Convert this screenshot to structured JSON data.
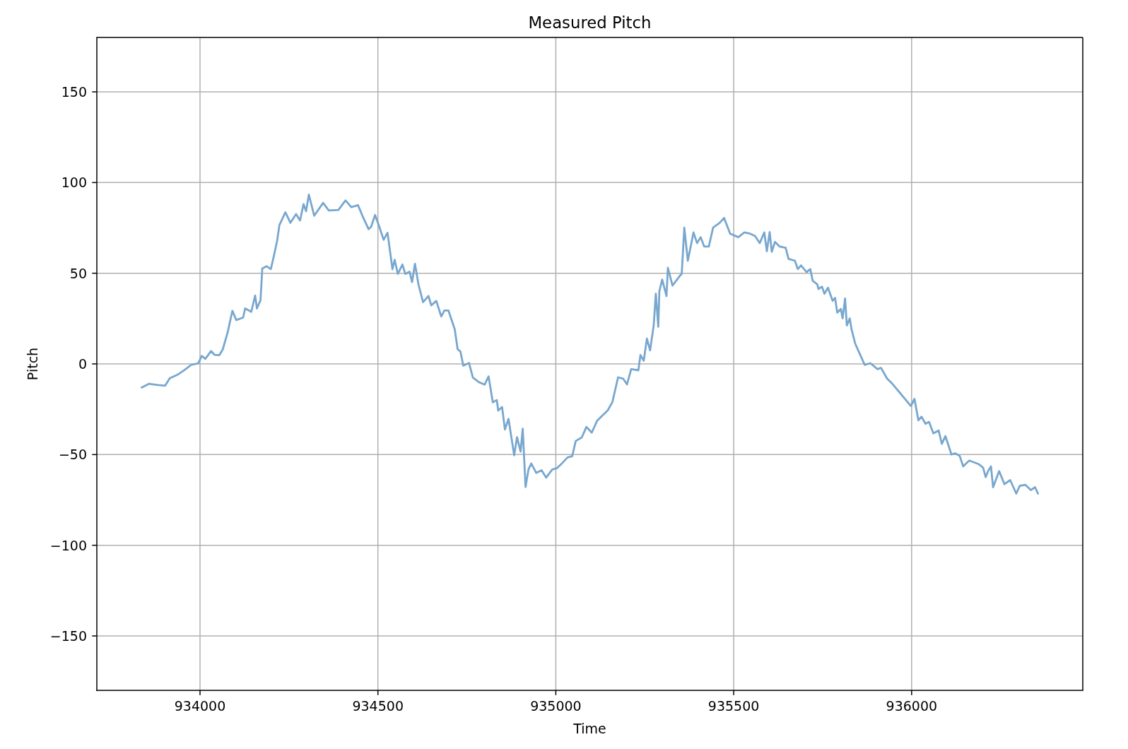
{
  "figure": {
    "chart_data": {
      "type": "line",
      "title": "Measured Pitch",
      "xlabel": "Time",
      "ylabel": "Pitch",
      "x": [
        933836,
        933856,
        933882,
        933902,
        933915,
        933938,
        933955,
        933975,
        933995,
        934005,
        934015,
        934031,
        934041,
        934054,
        934064,
        934078,
        934091,
        934102,
        934121,
        934127,
        934144,
        934155,
        934160,
        934170,
        934175,
        934187,
        934199,
        934207,
        934217,
        934223,
        934240,
        934254,
        934270,
        934281,
        934291,
        934298,
        934306,
        934321,
        934346,
        934362,
        934389,
        934409,
        934425,
        934444,
        934457,
        934474,
        934481,
        934492,
        934504,
        934516,
        934527,
        934541,
        934547,
        934556,
        934569,
        934577,
        934589,
        934596,
        934604,
        934614,
        934627,
        934642,
        934650,
        934664,
        934678,
        934687,
        934698,
        934716,
        934724,
        934732,
        934740,
        934756,
        934767,
        934784,
        934800,
        934811,
        934823,
        934834,
        934838,
        934849,
        934857,
        934867,
        934883,
        934891,
        934901,
        934907,
        934915,
        934923,
        934931,
        934945,
        934960,
        934973,
        934990,
        935003,
        935017,
        935033,
        935046,
        935056,
        935073,
        935086,
        935101,
        935116,
        935129,
        935146,
        935159,
        935175,
        935189,
        935200,
        935212,
        935232,
        935238,
        935247,
        935256,
        935265,
        935275,
        935281,
        935288,
        935291,
        935299,
        935311,
        935315,
        935328,
        935348,
        935354,
        935361,
        935371,
        935387,
        935397,
        935407,
        935417,
        935430,
        935442,
        935460,
        935473,
        935490,
        935513,
        935530,
        935546,
        935560,
        935573,
        935586,
        935593,
        935601,
        935607,
        935616,
        935629,
        935646,
        935654,
        935672,
        935680,
        935689,
        935705,
        935715,
        935722,
        935735,
        935738,
        935748,
        935755,
        935765,
        935778,
        935785,
        935791,
        935801,
        935806,
        935813,
        935818,
        935826,
        935831,
        935841,
        935854,
        935868,
        935884,
        935904,
        935914,
        935931,
        935944,
        935964,
        935983,
        935998,
        936008,
        936019,
        936028,
        936039,
        936049,
        936061,
        936076,
        936085,
        936095,
        936112,
        936122,
        936135,
        936145,
        936162,
        936188,
        936201,
        936208,
        936215,
        936223,
        936229,
        936246,
        936261,
        936277,
        936294,
        936304,
        936320,
        936335,
        936347,
        936355
      ],
      "series": [
        {
          "color": "#78a7cf",
          "values": [
            -13.0,
            -11.0,
            -11.6,
            -12.0,
            -7.9,
            -5.8,
            -3.6,
            -0.6,
            0.3,
            4.4,
            2.8,
            7.1,
            5.0,
            4.8,
            8.0,
            17.7,
            29.3,
            24.2,
            25.5,
            30.6,
            28.7,
            37.7,
            30.6,
            35.1,
            52.6,
            53.9,
            52.3,
            59.0,
            68.1,
            76.5,
            83.6,
            77.8,
            82.6,
            79.1,
            88.1,
            84.2,
            93.3,
            81.7,
            88.8,
            84.6,
            84.9,
            90.1,
            86.4,
            87.5,
            81.4,
            74.3,
            75.6,
            82.1,
            75.6,
            68.4,
            72.3,
            52.2,
            57.4,
            49.6,
            54.8,
            49.6,
            50.9,
            45.1,
            55.2,
            43.8,
            34.0,
            37.5,
            32.3,
            34.7,
            26.2,
            29.5,
            29.5,
            19.1,
            8.1,
            6.8,
            -1.0,
            0.5,
            -7.5,
            -10.1,
            -11.4,
            -6.9,
            -21.2,
            -19.9,
            -25.7,
            -23.8,
            -36.1,
            -30.3,
            -50.4,
            -40.4,
            -48.4,
            -35.7,
            -67.9,
            -58.2,
            -54.9,
            -60.1,
            -58.6,
            -62.7,
            -58.2,
            -57.5,
            -54.9,
            -51.6,
            -50.9,
            -42.5,
            -40.5,
            -34.7,
            -37.9,
            -31.4,
            -28.8,
            -25.6,
            -21.0,
            -7.4,
            -8.1,
            -11.3,
            -2.9,
            -3.5,
            4.9,
            1.7,
            14.0,
            7.5,
            21.2,
            38.7,
            20.5,
            40.0,
            46.5,
            37.4,
            53.0,
            43.2,
            48.4,
            49.7,
            75.1,
            56.9,
            72.5,
            66.6,
            69.9,
            64.7,
            64.7,
            75.1,
            77.7,
            80.5,
            71.8,
            69.9,
            72.5,
            71.8,
            70.5,
            66.6,
            72.5,
            62.1,
            72.7,
            61.8,
            67.3,
            64.7,
            64.0,
            57.9,
            56.9,
            52.3,
            54.3,
            50.6,
            52.3,
            45.8,
            43.9,
            41.3,
            42.6,
            38.7,
            42.0,
            34.8,
            36.4,
            28.3,
            30.3,
            25.1,
            36.1,
            21.2,
            25.1,
            19.2,
            11.4,
            5.6,
            -0.5,
            0.4,
            -2.9,
            -2.2,
            -8.1,
            -10.6,
            -15.2,
            -19.7,
            -23.2,
            -19.3,
            -31.1,
            -29.1,
            -33.0,
            -32.0,
            -38.3,
            -36.7,
            -44.1,
            -39.8,
            -50.0,
            -49.3,
            -50.7,
            -56.5,
            -53.3,
            -55.2,
            -57.2,
            -62.4,
            -59.1,
            -56.5,
            -68.0,
            -59.1,
            -66.3,
            -64.1,
            -71.5,
            -67.2,
            -66.7,
            -69.6,
            -68.0,
            -71.5
          ]
        }
      ],
      "xlim": [
        933710,
        936481
      ],
      "ylim": [
        -180,
        180
      ],
      "xticks": [
        934000,
        934500,
        935000,
        935500,
        936000
      ],
      "yticks": [
        {
          "value": -150,
          "label": "−150"
        },
        {
          "value": -100,
          "label": "−100"
        },
        {
          "value": -50,
          "label": "−50"
        },
        0,
        50,
        100,
        150
      ],
      "grid": true
    }
  }
}
